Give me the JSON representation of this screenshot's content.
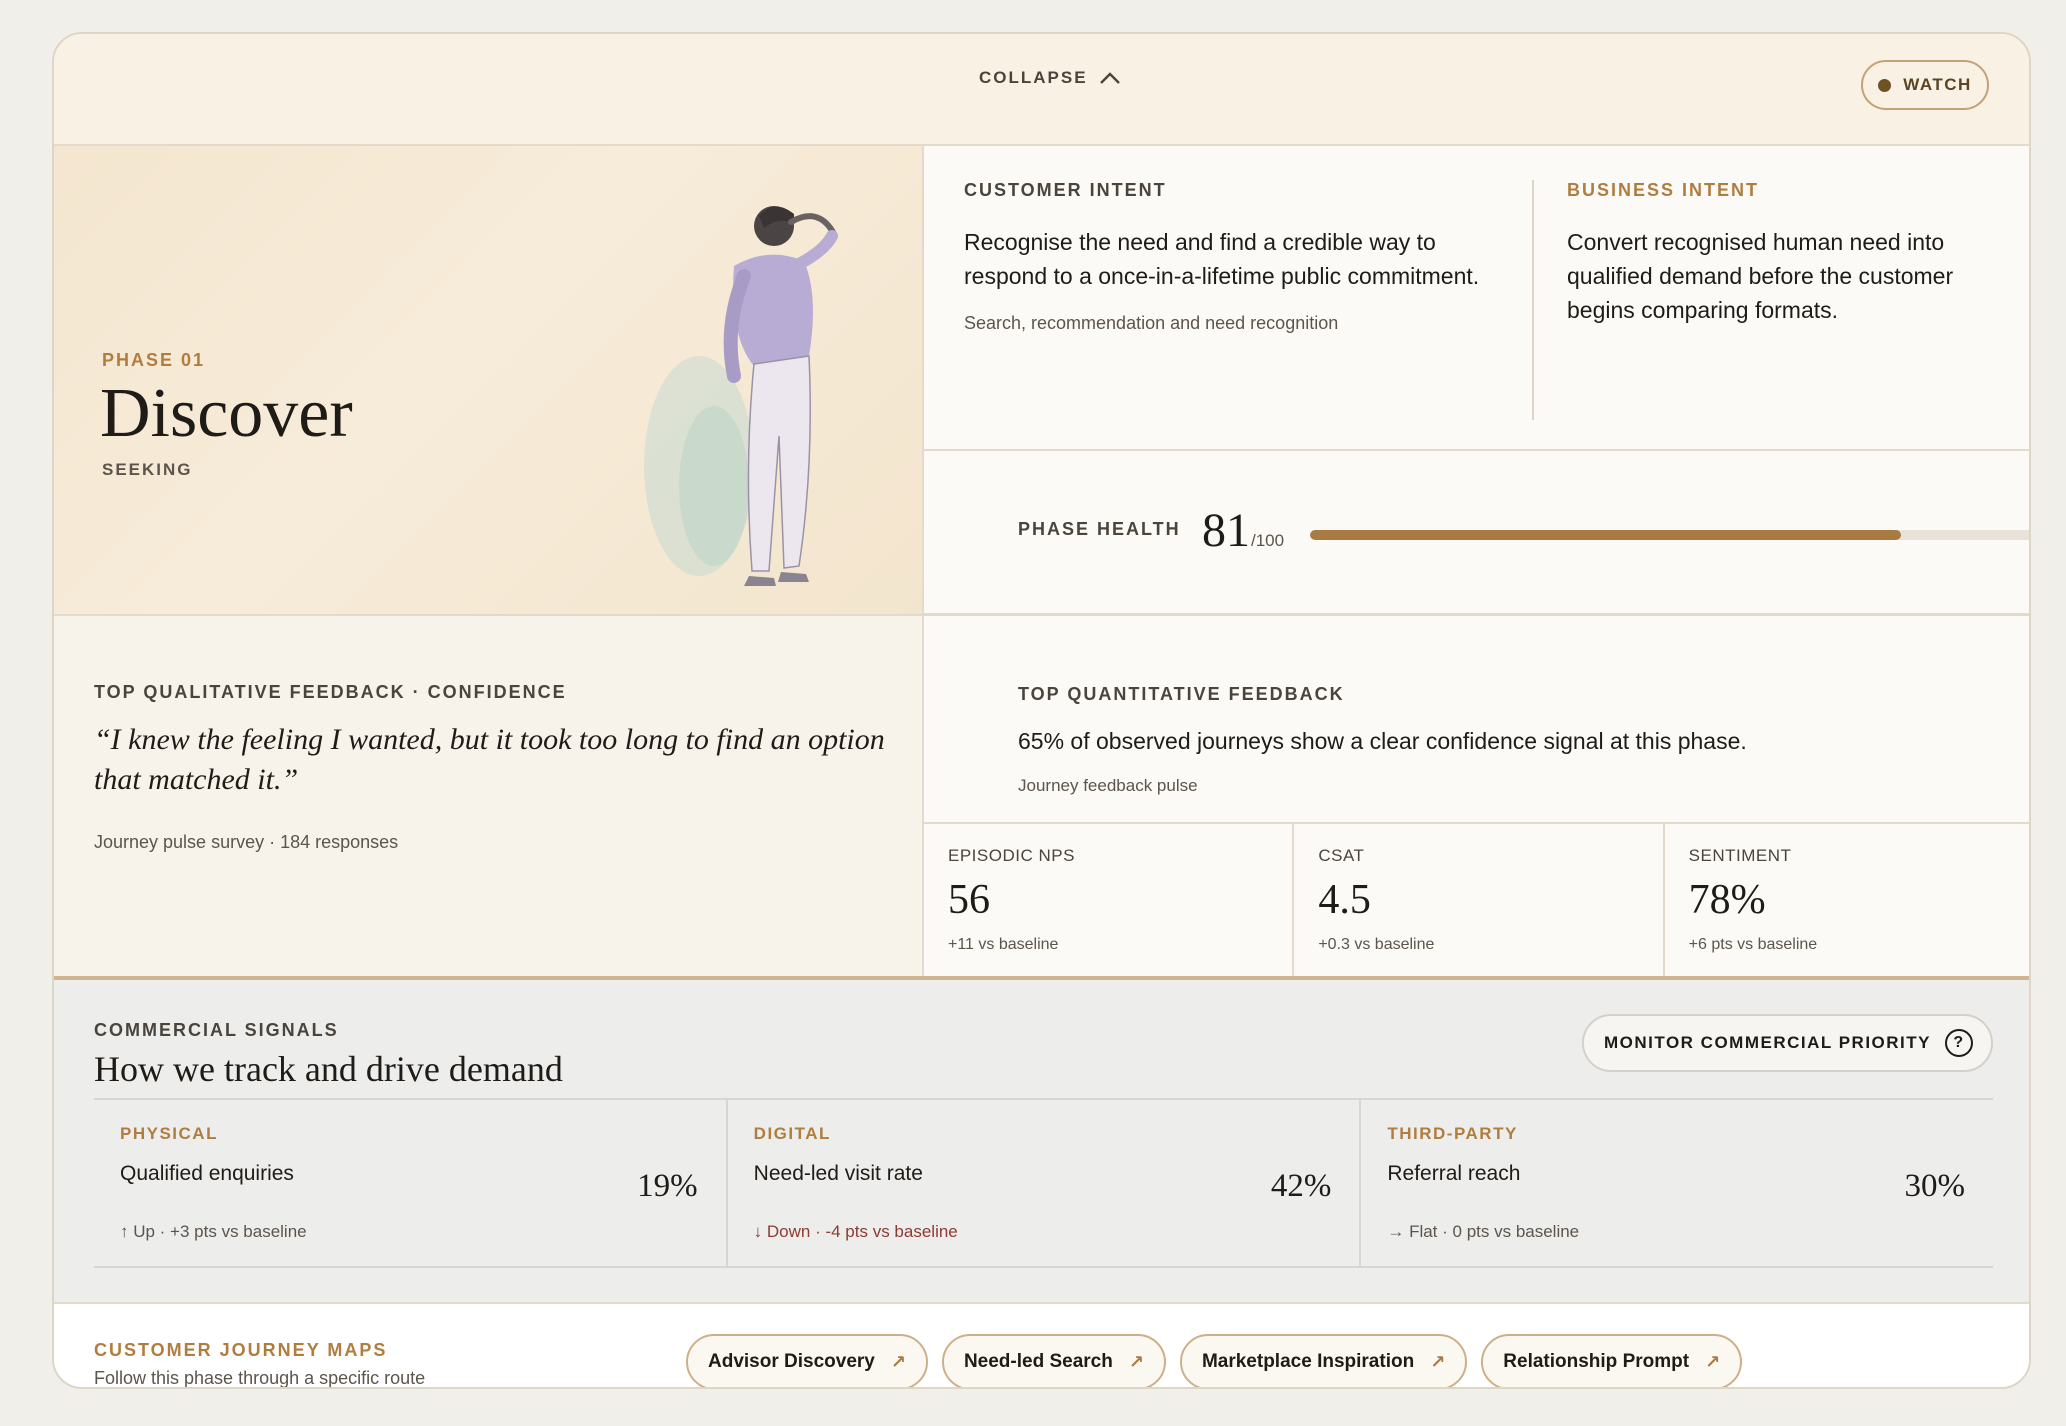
{
  "topbar": {
    "collapse_label": "COLLAPSE",
    "watch_label": "WATCH"
  },
  "phase": {
    "label": "PHASE 01",
    "title": "Discover",
    "subtitle": "SEEKING"
  },
  "intent": {
    "customer": {
      "heading": "CUSTOMER INTENT",
      "body": "Recognise the need and find a credible way to respond to a once-in-a-lifetime public commitment.",
      "note": "Search, recommendation and need recognition"
    },
    "business": {
      "heading": "BUSINESS INTENT",
      "body": "Convert recognised human need into qualified demand before the customer begins comparing formats."
    }
  },
  "health": {
    "label": "PHASE HEALTH",
    "score": "81",
    "max": "/100",
    "value": 81
  },
  "qualitative": {
    "heading": "TOP QUALITATIVE FEEDBACK · CONFIDENCE",
    "quote": "“I knew the feeling I wanted, but it took too long to find an option that matched it.”",
    "meta": "Journey pulse survey · 184 responses"
  },
  "quantitative": {
    "heading": "TOP QUANTITATIVE FEEDBACK",
    "body": "65% of observed journeys show a clear confidence signal at this phase.",
    "meta": "Journey feedback pulse",
    "metrics": [
      {
        "label": "EPISODIC NPS",
        "value": "56",
        "delta": "+11 vs baseline"
      },
      {
        "label": "CSAT",
        "value": "4.5",
        "delta": "+0.3 vs baseline"
      },
      {
        "label": "SENTIMENT",
        "value": "78%",
        "delta": "+6 pts vs baseline"
      }
    ]
  },
  "commercial": {
    "heading": "COMMERCIAL SIGNALS",
    "title": "How we track and drive demand",
    "monitor_label": "MONITOR COMMERCIAL PRIORITY",
    "help_glyph": "?",
    "channels": [
      {
        "label": "PHYSICAL",
        "name": "Qualified enquiries",
        "value": "19%",
        "trend": "↑ Up · +3 pts vs baseline"
      },
      {
        "label": "DIGITAL",
        "name": "Need-led visit rate",
        "value": "42%",
        "trend": "↓ Down · -4 pts vs baseline"
      },
      {
        "label": "THIRD-PARTY",
        "name": "Referral reach",
        "value": "30%",
        "trend": "→ Flat · 0 pts vs baseline"
      }
    ]
  },
  "journeys": {
    "heading": "CUSTOMER JOURNEY MAPS",
    "subtitle": "Follow this phase through a specific route",
    "arrow_glyph": "↗",
    "routes": [
      "Advisor Discovery",
      "Need-led Search",
      "Marketplace Inspiration",
      "Relationship Prompt"
    ]
  },
  "colors": {
    "accent": "#b07d3f",
    "progress": "#a97b42",
    "down": "#8e3b32"
  }
}
